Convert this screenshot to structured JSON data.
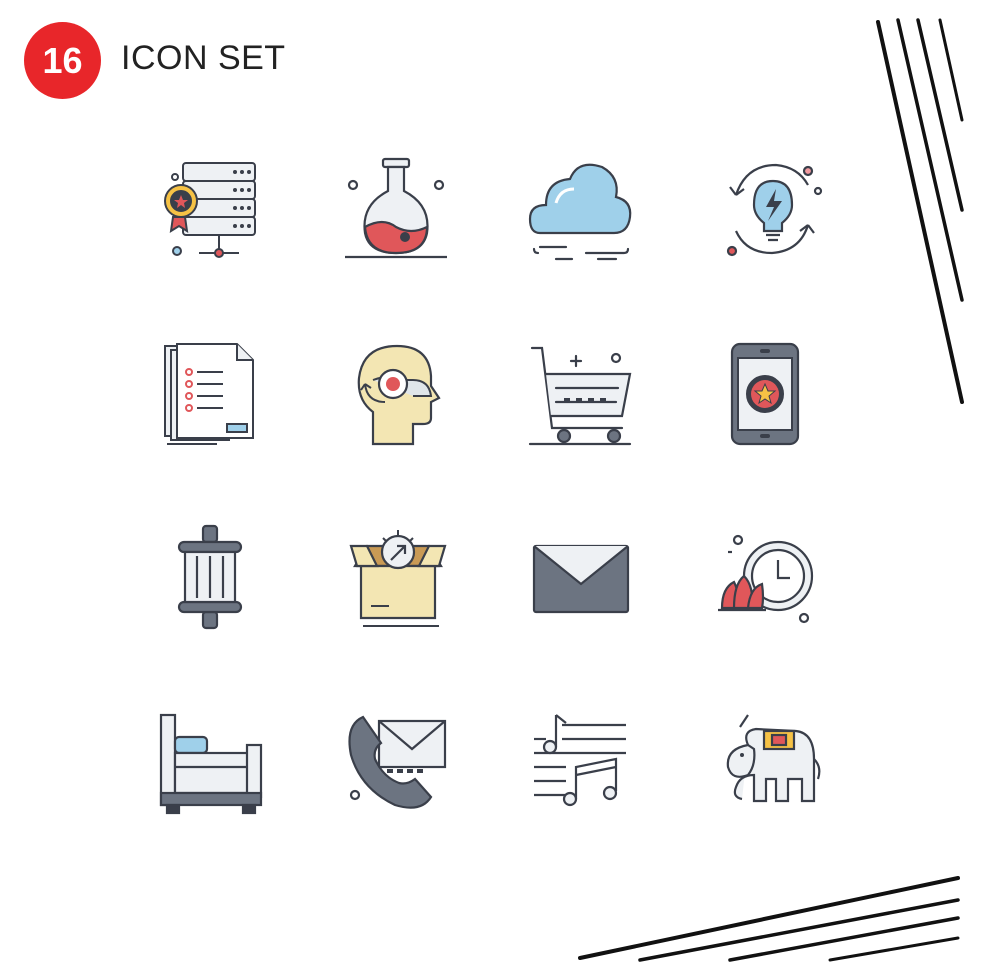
{
  "header": {
    "count": "16",
    "title": "ICON SET"
  },
  "colors": {
    "badge": "#e8262a",
    "outline": "#3a3f4a",
    "blue": "#9fd0ea",
    "gray": "#6c7481",
    "pink": "#f19a9f",
    "red": "#e0575a",
    "cream": "#f3e6b3",
    "yellow": "#f6c245",
    "light": "#eef1f4"
  },
  "icons": [
    "server-award-icon",
    "chemistry-flask-icon",
    "cloud-icon",
    "bulb-energy-cycle-icon",
    "documents-list-icon",
    "head-mind-refresh-icon",
    "shopping-cart-icon",
    "mobile-star-app-icon",
    "dumbbell-icon",
    "box-gear-icon",
    "mail-envelope-icon",
    "lotus-clock-icon",
    "bed-icon",
    "phone-mail-icon",
    "music-sheet-icon",
    "elephant-icon"
  ]
}
